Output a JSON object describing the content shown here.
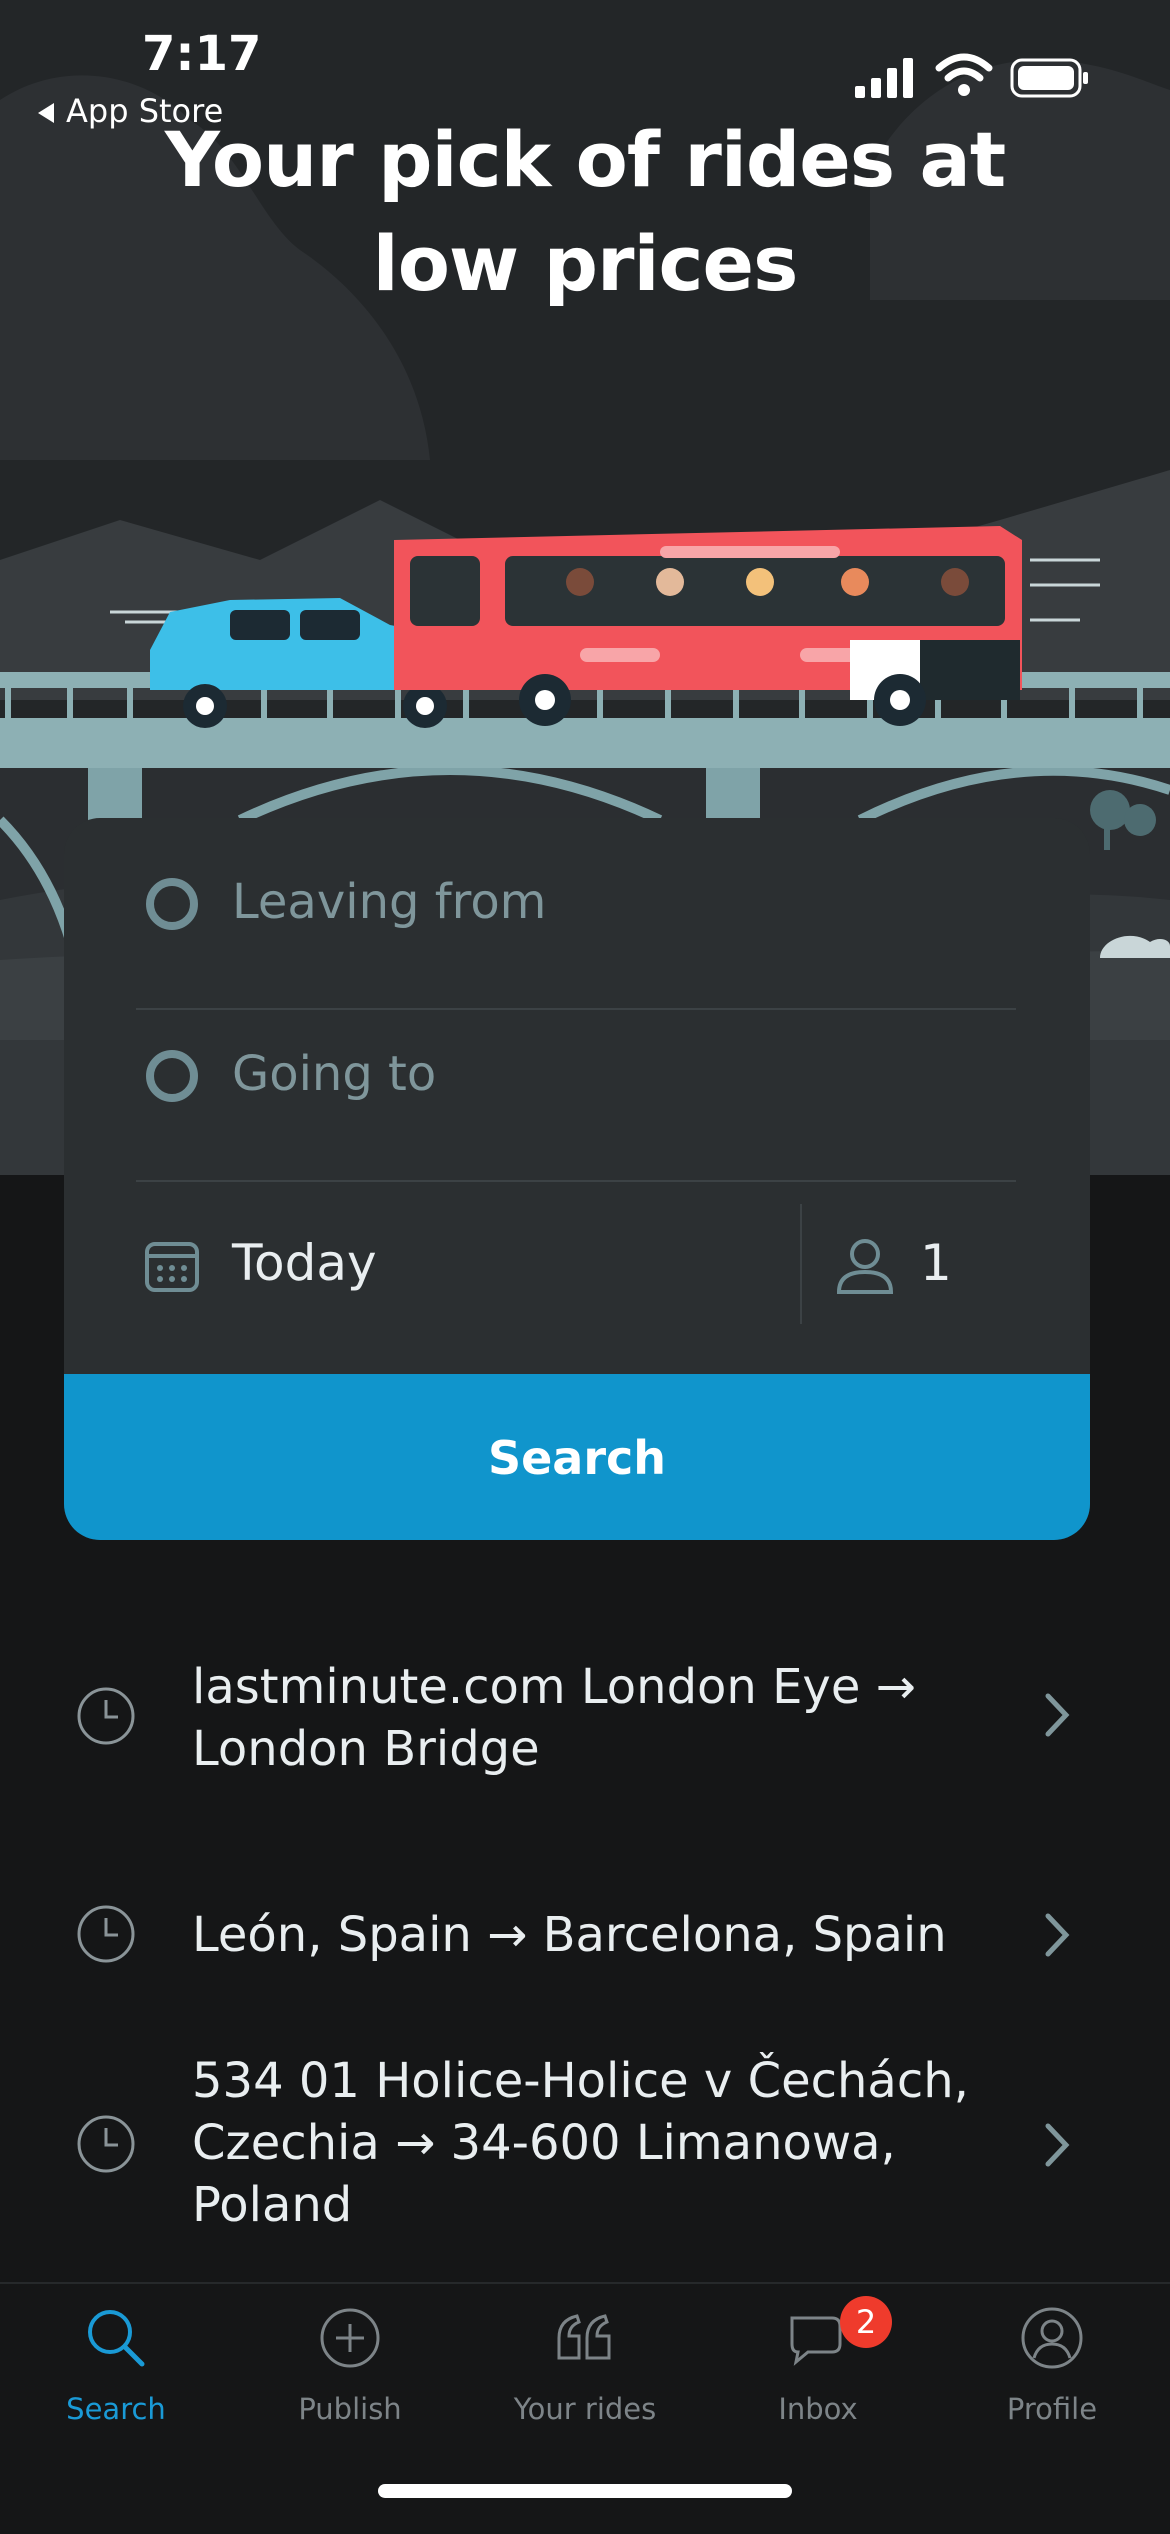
{
  "status_bar": {
    "time": "7:17",
    "back_label": "App Store"
  },
  "hero": {
    "headline": "Your pick of rides at low prices"
  },
  "search_form": {
    "from_placeholder": "Leaving from",
    "to_placeholder": "Going to",
    "date": "Today",
    "passengers": "1",
    "search_label": "Search"
  },
  "recent_searches": [
    {
      "text": "lastminute.com London Eye → London Bridge",
      "icon": "clock-icon"
    },
    {
      "text": "León, Spain → Barcelona, Spain",
      "icon": "clock-icon"
    },
    {
      "text": "534 01 Holice-Holice v Čechách, Czechia → 34-600 Limanowa, Poland",
      "icon": "clock-icon"
    }
  ],
  "tab_bar": {
    "items": [
      {
        "label": "Search",
        "icon": "search-icon",
        "active": true
      },
      {
        "label": "Publish",
        "icon": "plus-circle-icon",
        "active": false
      },
      {
        "label": "Your rides",
        "icon": "rides-icon",
        "active": false
      },
      {
        "label": "Inbox",
        "icon": "chat-icon",
        "active": false,
        "badge": "2"
      },
      {
        "label": "Profile",
        "icon": "profile-icon",
        "active": false
      }
    ]
  },
  "colors": {
    "accent": "#1095cc",
    "background": "#151617",
    "card": "#2b2f31",
    "badge": "#ef3b2c",
    "bus": "#f2545b",
    "car": "#3dbfe8"
  }
}
